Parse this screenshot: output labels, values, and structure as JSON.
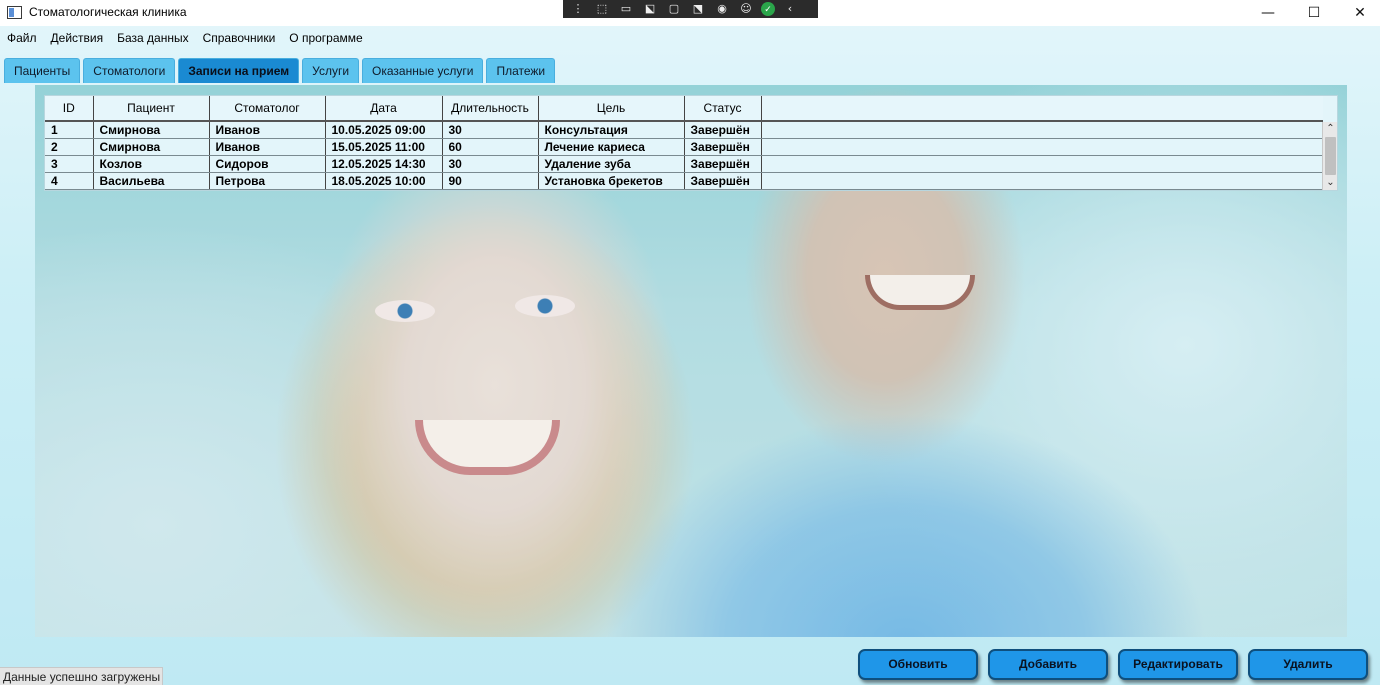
{
  "window": {
    "title": "Стоматологическая клиника",
    "minimize": "—",
    "maximize": "☐",
    "close": "✕"
  },
  "capture_toolbar": {
    "icons": [
      "grip-icon",
      "region-capture-icon",
      "video-icon",
      "pointer-capture-icon",
      "window-capture-icon",
      "select-capture-icon",
      "audio-icon",
      "accessibility-icon",
      "ok-icon",
      "collapse-icon"
    ]
  },
  "menu": {
    "items": [
      "Файл",
      "Действия",
      "База данных",
      "Справочники",
      "О программе"
    ]
  },
  "tabs": [
    {
      "label": "Пациенты",
      "active": false
    },
    {
      "label": "Стоматологи",
      "active": false
    },
    {
      "label": "Записи на прием",
      "active": true
    },
    {
      "label": "Услуги",
      "active": false
    },
    {
      "label": "Оказанные услуги",
      "active": false
    },
    {
      "label": "Платежи",
      "active": false
    }
  ],
  "grid": {
    "columns": [
      "ID",
      "Пациент",
      "Стоматолог",
      "Дата",
      "Длительность",
      "Цель",
      "Статус"
    ],
    "rows": [
      [
        "1",
        "Смирнова",
        "Иванов",
        "10.05.2025 09:00",
        "30",
        "Консультация",
        "Завершён"
      ],
      [
        "2",
        "Смирнова",
        "Иванов",
        "15.05.2025 11:00",
        "60",
        "Лечение кариеса",
        "Завершён"
      ],
      [
        "3",
        "Козлов",
        "Сидоров",
        "12.05.2025 14:30",
        "30",
        "Удаление зуба",
        "Завершён"
      ],
      [
        "4",
        "Васильева",
        "Петрова",
        "18.05.2025 10:00",
        "90",
        "Установка брекетов",
        "Завершён"
      ]
    ]
  },
  "buttons": {
    "refresh": "Обновить",
    "add": "Добавить",
    "edit": "Редактировать",
    "delete": "Удалить"
  },
  "status": "Данные успешно загружены",
  "colors": {
    "tab": "#5cc3ee",
    "tab_active": "#1a8ad2",
    "button": "#1f96e8"
  }
}
